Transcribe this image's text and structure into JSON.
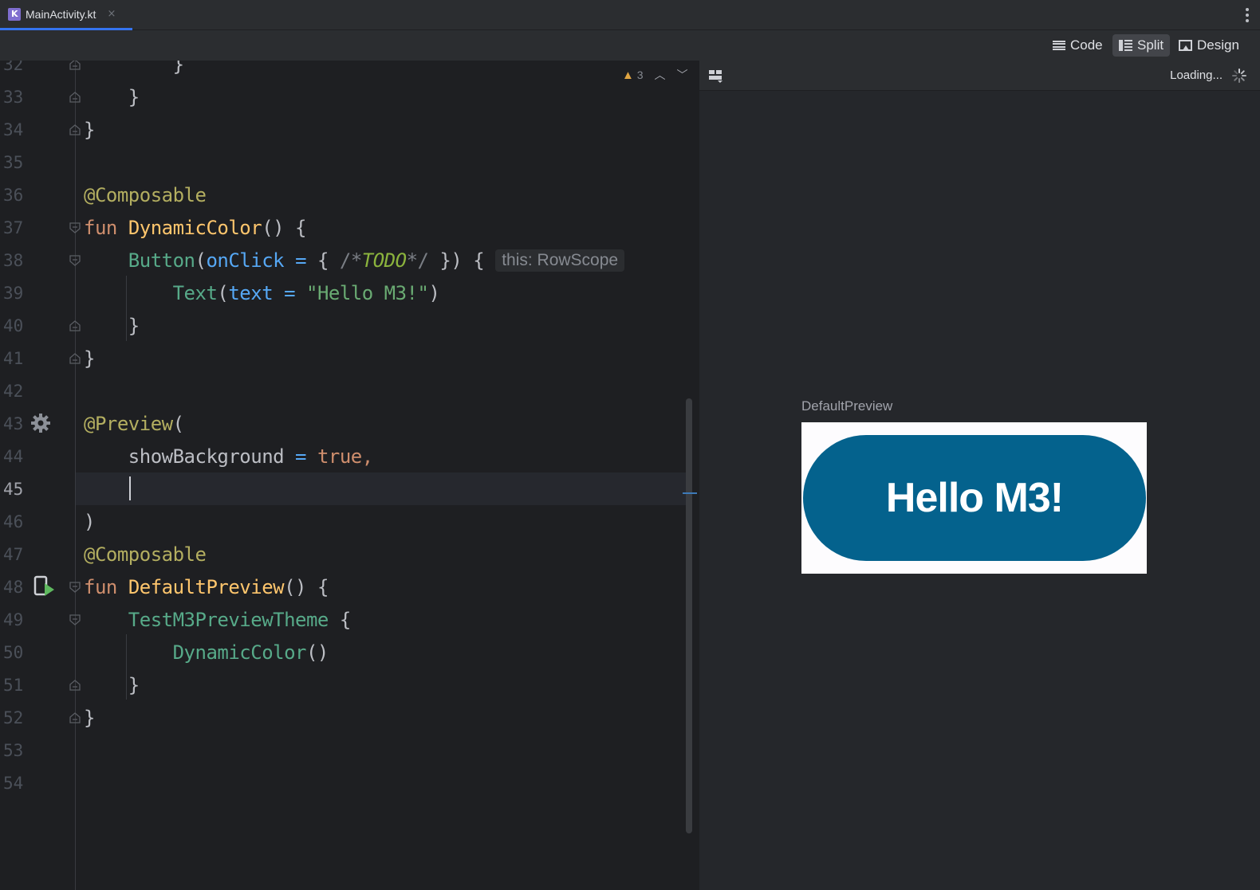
{
  "tab": {
    "filename": "MainActivity.kt",
    "close": "×"
  },
  "view_modes": {
    "code": "Code",
    "split": "Split",
    "design": "Design"
  },
  "inspection": {
    "warnings": "3"
  },
  "code_lines": [
    {
      "n": "32",
      "text": "        }"
    },
    {
      "n": "33",
      "text": "    }"
    },
    {
      "n": "34",
      "text": "}"
    },
    {
      "n": "35",
      "text": ""
    },
    {
      "n": "36",
      "text": "@Composable"
    },
    {
      "n": "37",
      "text": "fun DynamicColor() {"
    },
    {
      "n": "38",
      "text": "    Button(onClick = { /*TODO*/ }) { this: RowScope"
    },
    {
      "n": "39",
      "text": "        Text(text = \"Hello M3!\")"
    },
    {
      "n": "40",
      "text": "    }"
    },
    {
      "n": "41",
      "text": "}"
    },
    {
      "n": "42",
      "text": ""
    },
    {
      "n": "43",
      "text": "@Preview("
    },
    {
      "n": "44",
      "text": "    showBackground = true,"
    },
    {
      "n": "45",
      "text": ""
    },
    {
      "n": "46",
      "text": ")"
    },
    {
      "n": "47",
      "text": "@Composable"
    },
    {
      "n": "48",
      "text": "fun DefaultPreview() {"
    },
    {
      "n": "49",
      "text": "    TestM3PreviewTheme {"
    },
    {
      "n": "50",
      "text": "        DynamicColor()"
    },
    {
      "n": "51",
      "text": "    }"
    },
    {
      "n": "52",
      "text": "}"
    },
    {
      "n": "53",
      "text": ""
    },
    {
      "n": "54",
      "text": ""
    }
  ],
  "current_line": "45",
  "preview": {
    "status": "Loading...",
    "name": "DefaultPreview",
    "button_text": "Hello M3!",
    "button_color": "#04628d"
  },
  "colors": {
    "accent": "#3574f0",
    "editor_bg": "#1e1f22"
  }
}
